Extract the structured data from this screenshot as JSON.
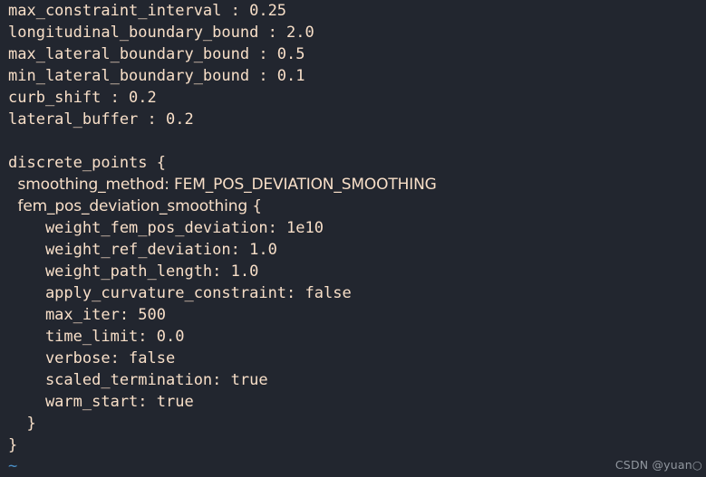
{
  "editor": {
    "background_color": "#22262f",
    "text_color": "#f8dfc8",
    "tilde_color": "#4a8fc7",
    "empty_line_marker": "~",
    "lines": [
      {
        "text": "max_constraint_interval : 0.25",
        "style": "mono"
      },
      {
        "text": "longitudinal_boundary_bound : 2.0",
        "style": "mono"
      },
      {
        "text": "max_lateral_boundary_bound : 0.5",
        "style": "mono"
      },
      {
        "text": "min_lateral_boundary_bound : 0.1",
        "style": "mono"
      },
      {
        "text": "curb_shift : 0.2",
        "style": "mono"
      },
      {
        "text": "lateral_buffer : 0.2",
        "style": "mono"
      },
      {
        "text": "",
        "style": "blank"
      },
      {
        "text": "discrete_points {",
        "style": "mono"
      },
      {
        "text": "  smoothing_method: FEM_POS_DEVIATION_SMOOTHING",
        "style": "fallback"
      },
      {
        "text": "  fem_pos_deviation_smoothing {",
        "style": "fallback"
      },
      {
        "text": "    weight_fem_pos_deviation: 1e10",
        "style": "mono"
      },
      {
        "text": "    weight_ref_deviation: 1.0",
        "style": "mono"
      },
      {
        "text": "    weight_path_length: 1.0",
        "style": "mono"
      },
      {
        "text": "    apply_curvature_constraint: false",
        "style": "mono"
      },
      {
        "text": "    max_iter: 500",
        "style": "mono"
      },
      {
        "text": "    time_limit: 0.0",
        "style": "mono"
      },
      {
        "text": "    verbose: false",
        "style": "mono"
      },
      {
        "text": "    scaled_termination: true",
        "style": "mono"
      },
      {
        "text": "    warm_start: true",
        "style": "mono"
      },
      {
        "text": "  }",
        "style": "mono"
      },
      {
        "text": "}",
        "style": "mono"
      }
    ],
    "config_values": {
      "max_constraint_interval": "0.25",
      "longitudinal_boundary_bound": "2.0",
      "max_lateral_boundary_bound": "0.5",
      "min_lateral_boundary_bound": "0.1",
      "curb_shift": "0.2",
      "lateral_buffer": "0.2",
      "discrete_points": {
        "smoothing_method": "FEM_POS_DEVIATION_SMOOTHING",
        "fem_pos_deviation_smoothing": {
          "weight_fem_pos_deviation": "1e10",
          "weight_ref_deviation": "1.0",
          "weight_path_length": "1.0",
          "apply_curvature_constraint": "false",
          "max_iter": "500",
          "time_limit": "0.0",
          "verbose": "false",
          "scaled_termination": "true",
          "warm_start": "true"
        }
      }
    }
  },
  "watermark": {
    "text": "CSDN @yuan○"
  }
}
